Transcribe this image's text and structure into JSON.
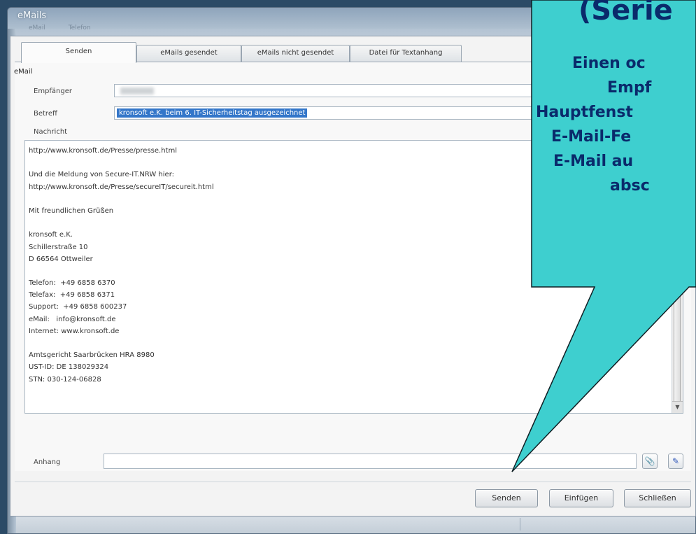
{
  "window": {
    "title": "eMails",
    "menu_ghost": [
      "eMail",
      "Telefon"
    ]
  },
  "tabs": [
    {
      "label": "Senden",
      "active": true
    },
    {
      "label": "eMails gesendet",
      "active": false
    },
    {
      "label": "eMails nicht gesendet",
      "active": false
    },
    {
      "label": "Datei für Textanhang",
      "active": false
    }
  ],
  "form": {
    "group_label": "eMail",
    "recipient_label": "Empfänger",
    "subject_label": "Betreff",
    "subject_value": "kronsoft e.K. beim 6. IT-Sicherheitstag ausgezeichnet",
    "message_label": "Nachricht",
    "message_lines": [
      "http://www.kronsoft.de/Presse/presse.html",
      "",
      "Und die Meldung von Secure-IT.NRW hier:",
      "http://www.kronsoft.de/Presse/secureIT/secureit.html",
      "",
      "Mit freundlichen Grüßen",
      "",
      "kronsoft e.K.",
      "Schillerstraße 10",
      "D 66564 Ottweiler",
      "",
      "Telefon:  +49 6858 6370",
      "Telefax:  +49 6858 6371",
      "Support:  +49 6858 600237",
      "eMail:   info@kronsoft.de",
      "Internet: www.kronsoft.de",
      "",
      "Amtsgericht Saarbrücken HRA 8980",
      "UST-ID: DE 138029324",
      "STN: 030-124-06828"
    ],
    "attachment_label": "Anhang",
    "attachment_value": ""
  },
  "buttons": {
    "send": "Senden",
    "insert": "Einfügen",
    "close": "Schließen"
  },
  "callout": {
    "title": "(Serie",
    "lines": [
      "Einen oc",
      "Empf",
      "Hauptfenst",
      "E-Mail-Fe",
      "E-Mail au",
      "absc"
    ],
    "color_fill": "#3ecfcf",
    "color_text": "#0a2a6b"
  }
}
